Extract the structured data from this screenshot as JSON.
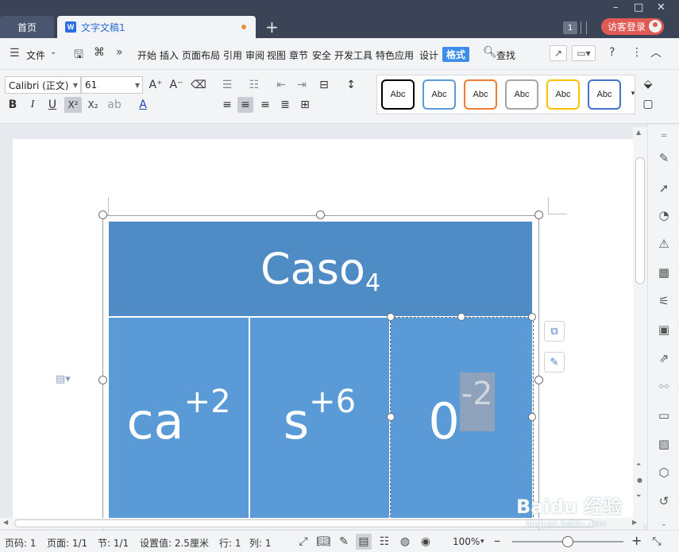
{
  "titlebar": {
    "home_tab": "首页",
    "doc_tab": "文字文稿1",
    "doc_icon": "W",
    "add_tab": "+",
    "window_badge": "1",
    "login_label": "访客登录",
    "controls": [
      "–",
      "□",
      "✕"
    ]
  },
  "menubar": {
    "file_label": "文件",
    "items": [
      "开始",
      "插入",
      "页面布局",
      "引用",
      "审阅",
      "视图",
      "章节",
      "安全",
      "开发工具",
      "特色应用",
      "设计"
    ],
    "active_item": "格式",
    "search_label": "查找"
  },
  "ribbon": {
    "font_name": "Calibri (正文)",
    "font_size": "61",
    "format_buttons": {
      "bold": "B",
      "italic": "I",
      "underline": "U",
      "superscript": "X²",
      "subscript": "X₂"
    },
    "style_boxes": [
      "Abc",
      "Abc",
      "Abc",
      "Abc",
      "Abc",
      "Abc"
    ],
    "style_colors": [
      "#000000",
      "#5b9bd5",
      "#ed7d31",
      "#a5a5a5",
      "#ffc000",
      "#4472c4"
    ]
  },
  "document": {
    "header_formula": "Caso",
    "header_subscript": "4",
    "cells": [
      {
        "base": "ca",
        "sup": "+2"
      },
      {
        "base": "s",
        "sup": "+6"
      },
      {
        "base": "0",
        "sup": "-2"
      }
    ],
    "colors": {
      "header_fill": "#4f8cc6",
      "cell_fill": "#5a9ad6"
    }
  },
  "statusbar": {
    "page_code": "页码: 1",
    "page": "页面: 1/1",
    "section": "节: 1/1",
    "setting": "设置值: 2.5厘米",
    "row": "行: 1",
    "col": "列: 1",
    "zoom": "100%"
  },
  "watermark": {
    "text": "Baidu 经验",
    "url": "jingyan.baidu.com"
  }
}
